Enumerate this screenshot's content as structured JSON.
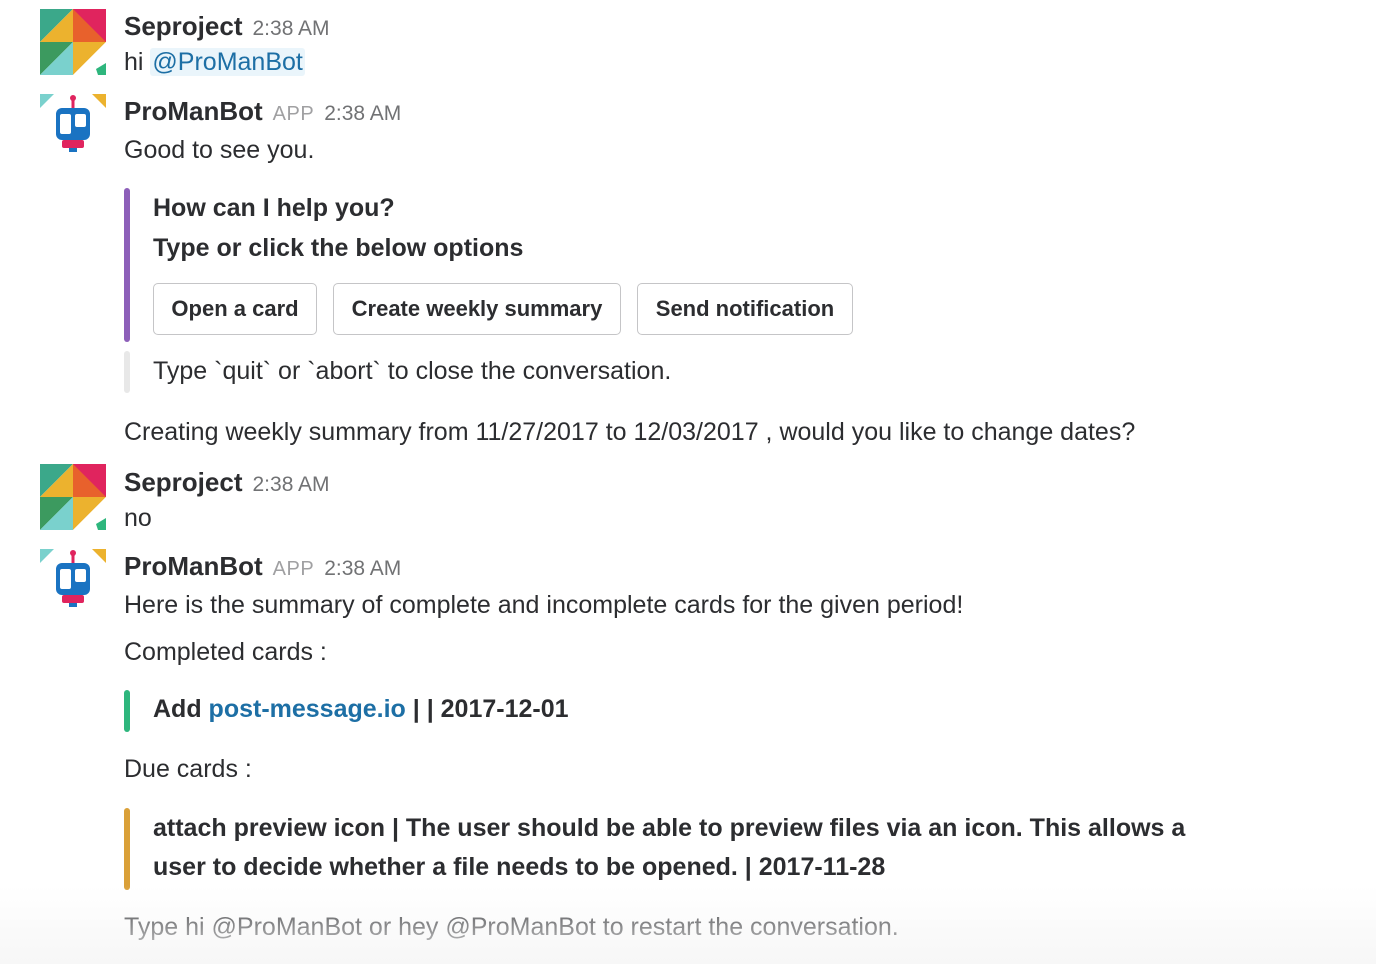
{
  "messages": [
    {
      "author": "Seproject",
      "time": "2:38 AM",
      "text_prefix": "hi ",
      "mention": "@ProManBot"
    },
    {
      "author": "ProManBot",
      "badge": "APP",
      "time": "2:38 AM",
      "text": "Good to see you.",
      "attachment": {
        "title": "How can I help you?",
        "subtitle": "Type or click the below options",
        "accent_color": "#8d5fb9",
        "buttons": [
          "Open a card",
          "Create weekly summary",
          "Send notification"
        ]
      },
      "footer_attachment": {
        "text": "Type `quit` or `abort` to close the conversation.",
        "accent_color": "#e8e8e8"
      },
      "followup": "Creating weekly summary from 11/27/2017 to 12/03/2017 , would you like to change dates?"
    },
    {
      "author": "Seproject",
      "time": "2:38 AM",
      "text": "no"
    },
    {
      "author": "ProManBot",
      "badge": "APP",
      "time": "2:38 AM",
      "text": "Here is the summary of complete and incomplete cards for the given period!",
      "completed_label": "Completed cards :",
      "completed_card": {
        "prefix": "Add ",
        "link": "post-message.io",
        "suffix": " |  | 2017-12-01",
        "accent_color": "#2eb67d"
      },
      "due_label": "Due cards :",
      "due_card": {
        "line1": "attach preview icon | The user should be able to preview files via an icon. This allows a",
        "line2": "user to decide whether a file needs to be opened. | 2017-11-28",
        "accent_color": "#daa038"
      },
      "restart_hint": "Type hi @ProManBot or hey @ProManBot to restart the conversation."
    }
  ],
  "colors": {
    "link": "#1d6fa5",
    "text": "#2c2d30",
    "muted": "#717274"
  },
  "icons": {
    "seproject_avatar": "slack-style-diamond-avatar",
    "bot_avatar": "trello-board-bot-avatar"
  }
}
